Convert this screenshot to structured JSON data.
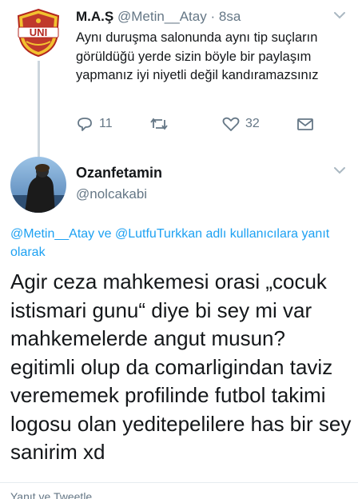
{
  "tweet1": {
    "name": "M.A.Ş",
    "handle": "@Metin__Atay",
    "separator": "·",
    "time": "8sa",
    "text": "Aynı duruşma salonunda aynı tip suçların görüldüğü yerde sizin böyle bir paylaşım yapmanız iyi niyetli değil kandıramazsınız",
    "avatar_logo_text": "UNI",
    "actions": {
      "reply_icon": "reply-icon",
      "reply_count": "11",
      "retweet_icon": "retweet-icon",
      "like_icon": "heart-icon",
      "like_count": "32",
      "share_icon": "mail-icon"
    }
  },
  "tweet2": {
    "name": "Ozanfetamin",
    "handle": "@nolcakabi",
    "replying": {
      "mention1": "@Metin__Atay",
      "connector": " ve ",
      "mention2": "@LutfuTurkkan",
      "suffix": " adlı kullanıcılara yanıt olarak"
    },
    "text": "Agir ceza mahkemesi orasi „cocuk istismari gunu“ diye bi sey mi var mahkemelerde angut musun? egitimli olup da comarligindan taviz verememek profilinde futbol takimi logosu olan yeditepelilere has bir sey sanirim xd",
    "bottom_peek": "Yanıt ve Tweetle..."
  },
  "colors": {
    "link": "#1da1f2",
    "secondary_text": "#657786",
    "primary_text": "#14171a",
    "thread_line": "#ccd6dd"
  }
}
